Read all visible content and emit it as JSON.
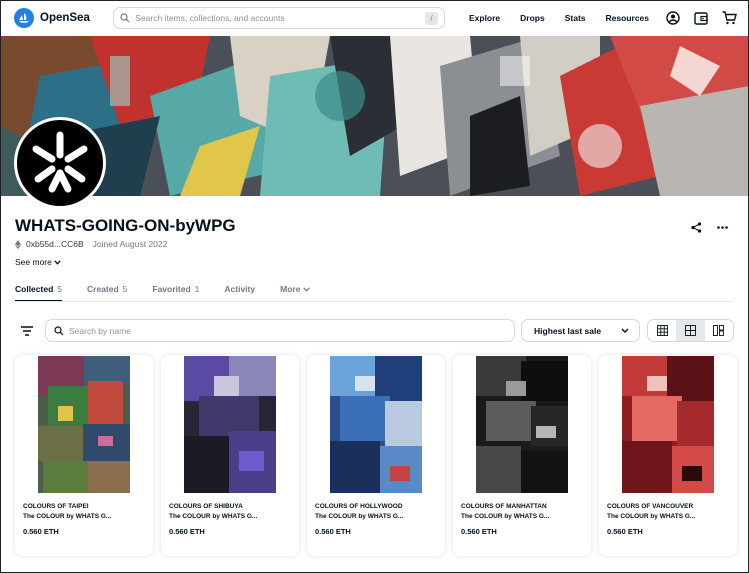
{
  "header": {
    "brand": "OpenSea",
    "search_placeholder": "Search items, collections, and accounts",
    "search_shortcut": "/",
    "nav": [
      "Explore",
      "Drops",
      "Stats",
      "Resources"
    ],
    "icons": [
      "account-icon",
      "wallet-icon",
      "cart-icon"
    ]
  },
  "profile": {
    "name": "WHATS-GOING-ON-byWPG",
    "address": "0xb55d...CC6B",
    "joined": "Joined August 2022",
    "see_more": "See more"
  },
  "tabs": [
    {
      "label": "Collected",
      "count": "5",
      "active": true
    },
    {
      "label": "Created",
      "count": "5",
      "active": false
    },
    {
      "label": "Favorited",
      "count": "1",
      "active": false
    },
    {
      "label": "Activity",
      "count": "",
      "active": false
    },
    {
      "label": "More",
      "count": "",
      "active": false
    }
  ],
  "toolbar": {
    "search_placeholder": "Search by name",
    "sort_label": "Highest last sale",
    "view_modes": [
      "large-grid-icon",
      "grid-icon",
      "compact-icon"
    ],
    "selected_view": 1
  },
  "items": [
    {
      "name": "COLOURS OF TAIPEI",
      "collection": "The COLOUR by WHATS G...",
      "price": "0.560 ETH"
    },
    {
      "name": "COLOURS OF SHIBUYA",
      "collection": "The COLOUR by WHATS G...",
      "price": "0.560 ETH"
    },
    {
      "name": "COLOURS OF HOLLYWOOD",
      "collection": "The COLOUR by WHATS G...",
      "price": "0.560 ETH"
    },
    {
      "name": "COLOURS OF MANHATTAN",
      "collection": "The COLOUR by WHATS G...",
      "price": "0.560 ETH"
    },
    {
      "name": "COLOURS OF VANCOUVER",
      "collection": "The COLOUR by WHATS G...",
      "price": "0.560 ETH"
    }
  ],
  "colors": {
    "brand_blue": "#2081e2",
    "text_dark": "#04111d",
    "text_muted": "#707a83"
  }
}
